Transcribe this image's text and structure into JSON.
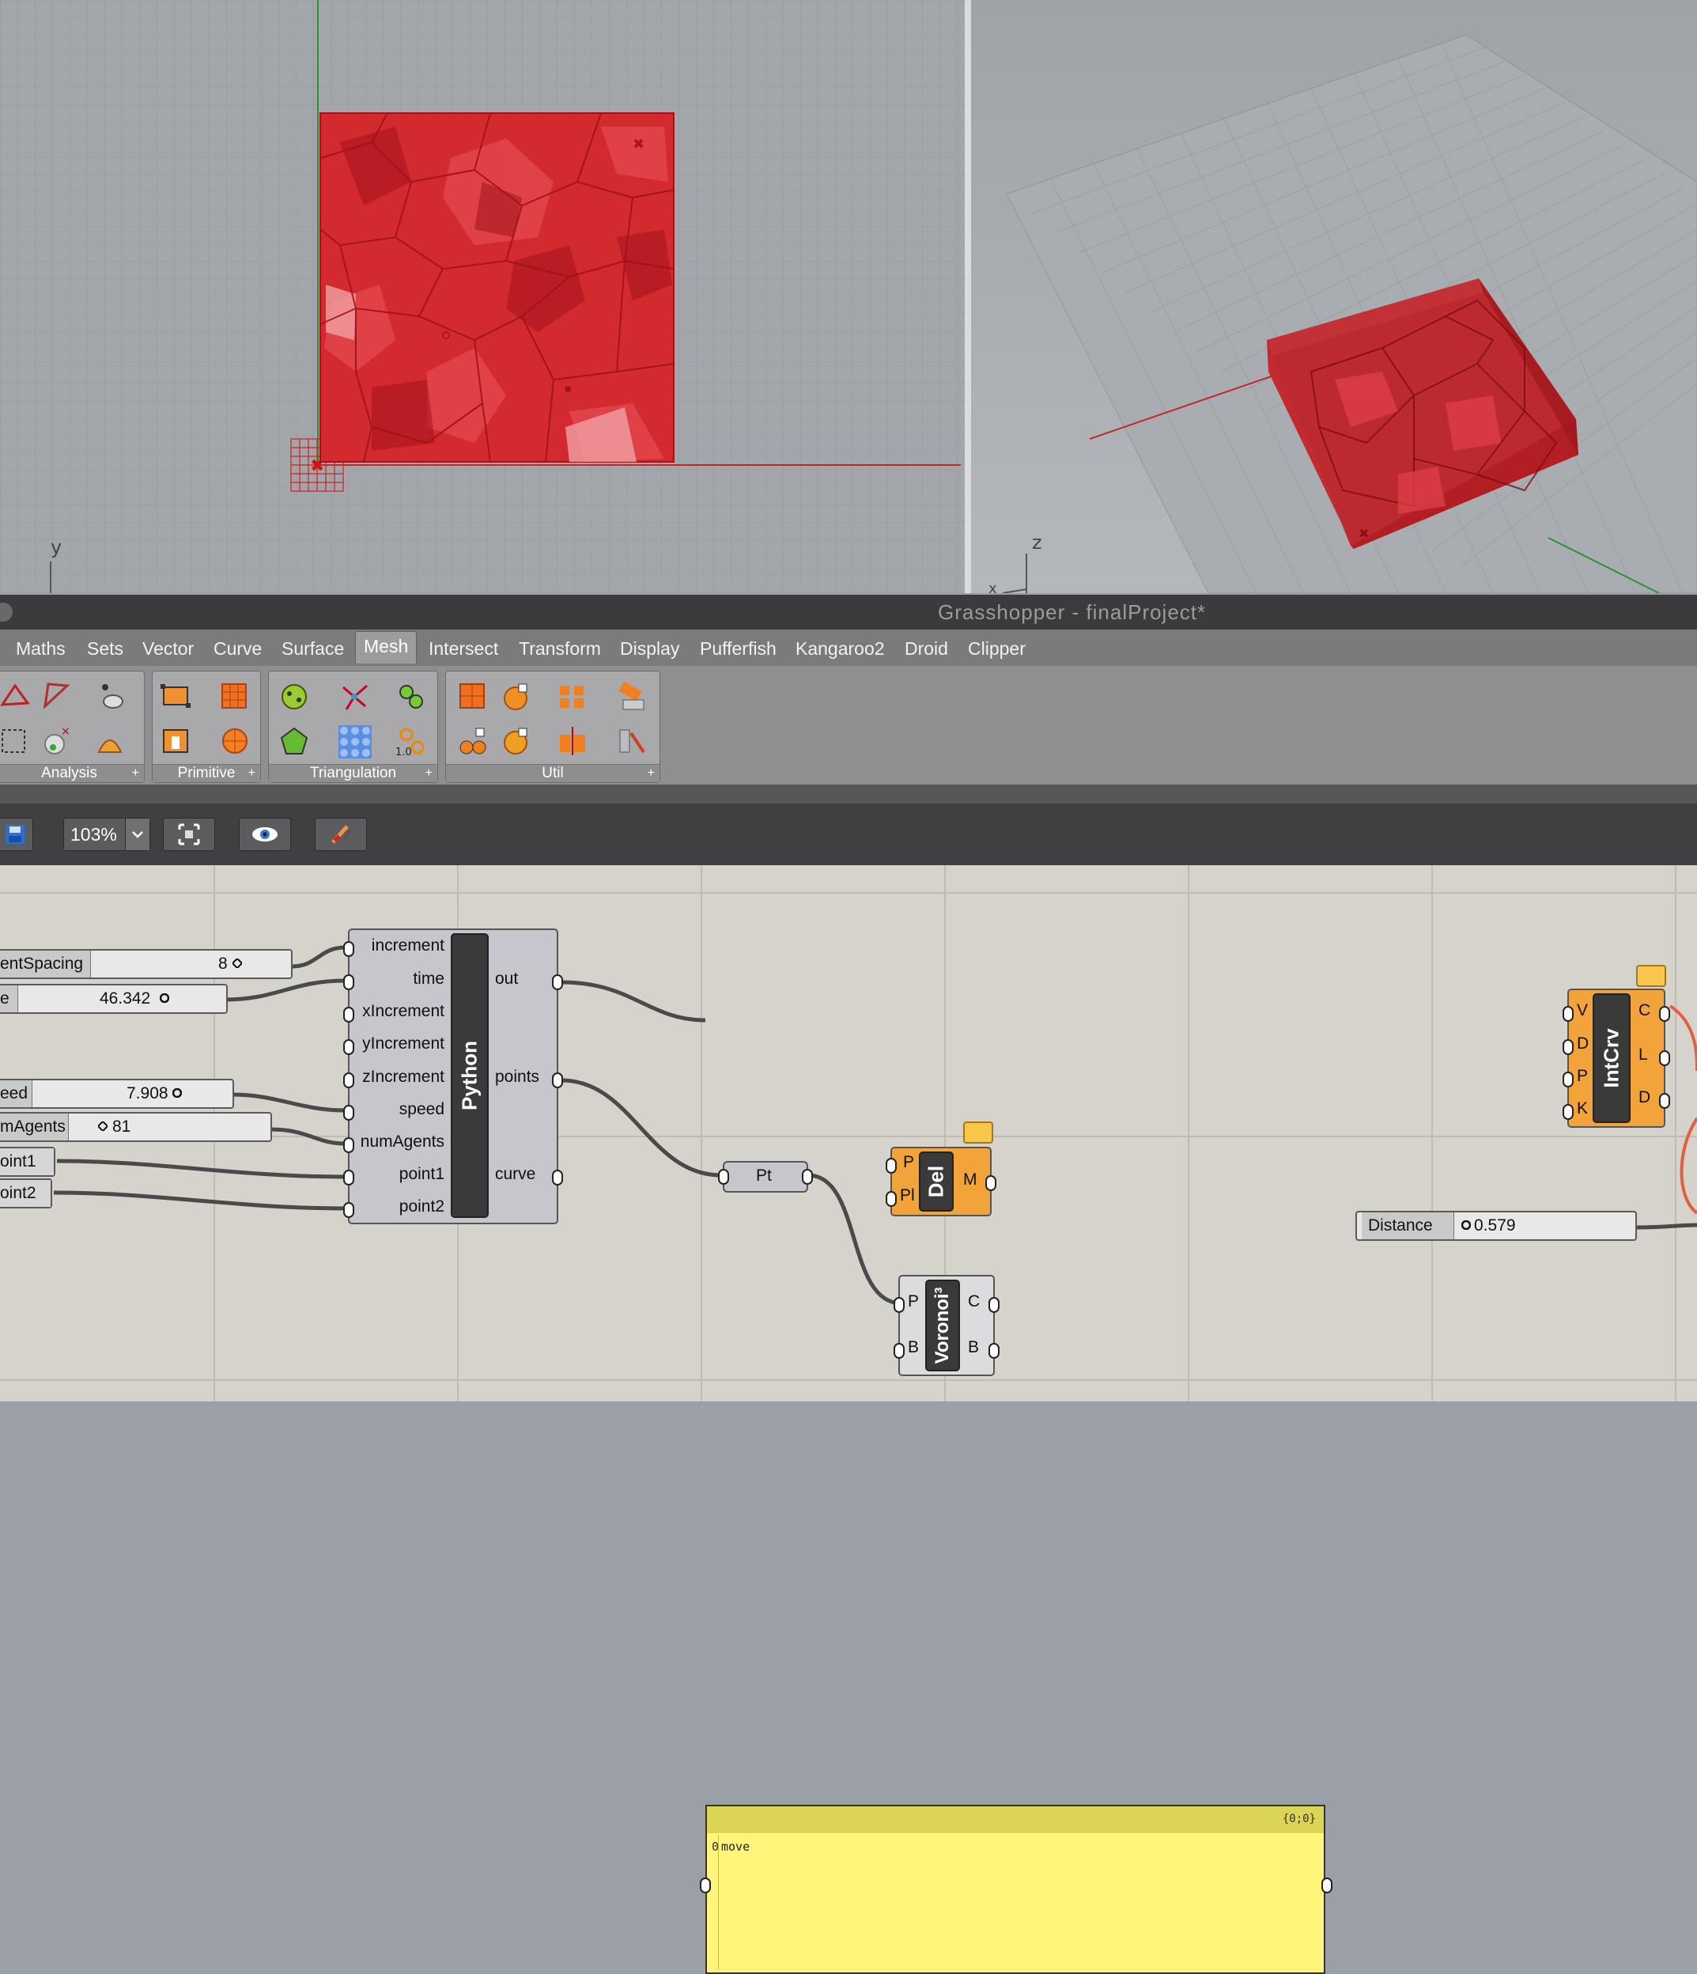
{
  "viewports": {
    "top": {
      "axis_label": "y"
    },
    "perspective": {
      "axis_label": "z",
      "x_axis_label": "x"
    }
  },
  "window": {
    "title": "Grasshopper - finalProject*"
  },
  "tabs": [
    {
      "label": "Maths",
      "active": false
    },
    {
      "label": "Sets",
      "active": false
    },
    {
      "label": "Vector",
      "active": false
    },
    {
      "label": "Curve",
      "active": false
    },
    {
      "label": "Surface",
      "active": false
    },
    {
      "label": "Mesh",
      "active": true
    },
    {
      "label": "Intersect",
      "active": false
    },
    {
      "label": "Transform",
      "active": false
    },
    {
      "label": "Display",
      "active": false
    },
    {
      "label": "Pufferfish",
      "active": false
    },
    {
      "label": "Kangaroo2",
      "active": false
    },
    {
      "label": "Droid",
      "active": false
    },
    {
      "label": "Clipper",
      "active": false
    }
  ],
  "ribbon_groups": [
    {
      "label": "Analysis"
    },
    {
      "label": "Primitive"
    },
    {
      "label": "Triangulation",
      "icon_text": "1.0"
    },
    {
      "label": "Util"
    }
  ],
  "toolbar": {
    "zoom": "103%"
  },
  "canvas": {
    "sliders": [
      {
        "name": "entSpacing",
        "value": "8"
      },
      {
        "name": "e",
        "value": "46.342"
      },
      {
        "name": "eed",
        "value": "7.908"
      },
      {
        "name": "mAgents",
        "value": "81"
      },
      {
        "name": "Distance",
        "value": "0.579"
      }
    ],
    "params": [
      {
        "name": "oint1"
      },
      {
        "name": "oint2"
      }
    ],
    "python": {
      "name": "Python",
      "inputs": [
        "increment",
        "time",
        "xIncrement",
        "yIncrement",
        "zIncrement",
        "speed",
        "numAgents",
        "point1",
        "point2"
      ],
      "outputs": [
        "out",
        "points",
        "curve"
      ]
    },
    "panel": {
      "path": "{0;0}",
      "index": "0",
      "value": "move"
    },
    "pt": {
      "label": "Pt"
    },
    "del": {
      "name": "Del",
      "inputs": [
        "P",
        "Pl"
      ],
      "outputs": [
        "M"
      ]
    },
    "voronoi": {
      "name": "Voronoi³",
      "inputs": [
        "P",
        "B"
      ],
      "outputs": [
        "C",
        "B"
      ]
    },
    "intcrv": {
      "name": "IntCrv",
      "inputs": [
        "V",
        "D",
        "P",
        "K"
      ],
      "outputs": [
        "C",
        "L",
        "D"
      ]
    }
  },
  "colors": {
    "mesh_red": "#d9252b",
    "component_orange": "#f2a33a",
    "panel_yellow": "#fff57a"
  }
}
